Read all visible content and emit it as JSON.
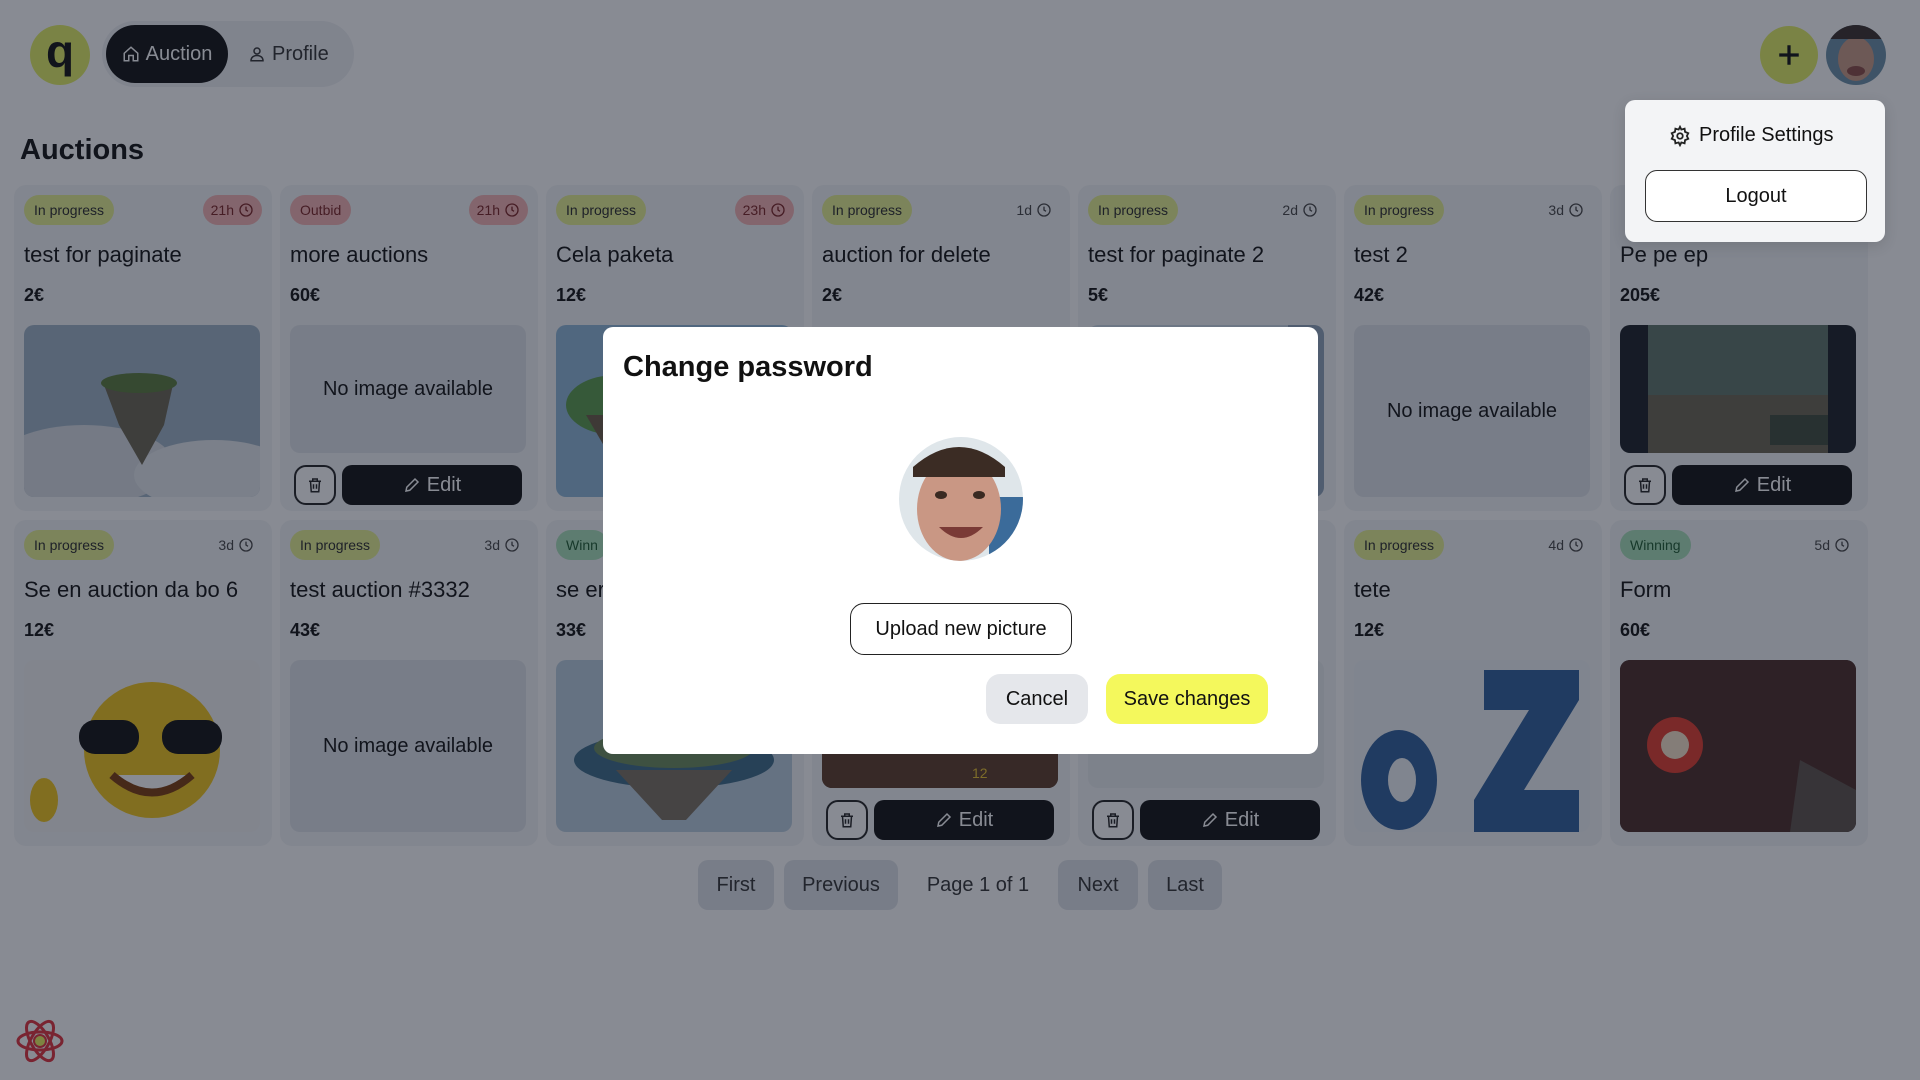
{
  "header": {
    "logo_letter": "q",
    "nav": [
      {
        "label": "Auction",
        "icon": "home-icon",
        "active": true
      },
      {
        "label": "Profile",
        "icon": "user-icon",
        "active": false
      }
    ],
    "plus_label": "+"
  },
  "page_title": "Auctions",
  "cards": [
    {
      "status": "In progress",
      "time": "21h",
      "title": "test for paginate",
      "price": "2€",
      "image": "floating-island-clouds",
      "has_actions": false
    },
    {
      "status": "Outbid",
      "time": "21h",
      "title": "more auctions",
      "price": "60€",
      "no_image": "No image available",
      "has_actions": true,
      "edit_label": "Edit"
    },
    {
      "status": "In progress",
      "time": "23h",
      "title": "Cela paketa",
      "price": "12€",
      "image": "floating-island-green",
      "has_actions": false
    },
    {
      "status": "In progress",
      "time": "1d",
      "title": "auction for delete",
      "price": "2€",
      "has_actions": false
    },
    {
      "status": "In progress",
      "time": "2d",
      "title": "test for paginate 2",
      "price": "5€",
      "has_actions": false
    },
    {
      "status": "In progress",
      "time": "3d",
      "title": "test 2",
      "price": "42€",
      "no_image": "No image available",
      "has_actions": false
    },
    {
      "status": "",
      "time": "",
      "title": "Pe pe ep",
      "price": "205€",
      "image": "game-screenshot",
      "has_actions": true,
      "edit_label": "Edit"
    },
    {
      "status": "In progress",
      "time": "3d",
      "title": "Se en auction da bo 6",
      "price": "12€",
      "image": "sunglasses-smiley",
      "has_actions": false
    },
    {
      "status": "In progress",
      "time": "3d",
      "title": "test auction #3332",
      "price": "43€",
      "no_image": "No image available",
      "has_actions": false
    },
    {
      "status": "Winn",
      "time": "",
      "title": "se er",
      "price": "33€",
      "image": "floating-city",
      "has_actions": false
    },
    {
      "status": "",
      "time": "",
      "title": "",
      "price": "",
      "image": "game-screenshot-2",
      "has_actions": true,
      "edit_label": "Edit"
    },
    {
      "status": "",
      "time": "",
      "title": "",
      "price": "",
      "has_actions": true,
      "edit_label": "Edit"
    },
    {
      "status": "In progress",
      "time": "4d",
      "title": "tete",
      "price": "12€",
      "image": "ez-logo",
      "has_actions": false
    },
    {
      "status": "Winning",
      "time": "5d",
      "title": "Form",
      "price": "60€",
      "image": "quake-screenshot",
      "has_actions": false
    }
  ],
  "pagination": {
    "first": "First",
    "previous": "Previous",
    "page_info": "Page 1 of 1",
    "next": "Next",
    "last": "Last"
  },
  "dropdown": {
    "settings_label": "Profile Settings",
    "logout_label": "Logout"
  },
  "modal": {
    "title": "Change password",
    "upload_label": "Upload new picture",
    "cancel_label": "Cancel",
    "save_label": "Save changes"
  },
  "colors": {
    "accent": "#e2ef63",
    "save": "#f4f85c",
    "dark": "#111111",
    "in_progress": "#e6f08e",
    "outbid": "#f4b3b3",
    "winning": "#a9e0b8"
  }
}
